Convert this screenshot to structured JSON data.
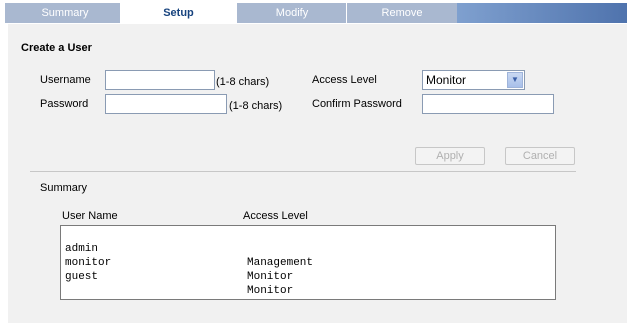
{
  "tabs": [
    {
      "label": "Summary",
      "active": false
    },
    {
      "label": "Setup",
      "active": true
    },
    {
      "label": "Modify",
      "active": false
    },
    {
      "label": "Remove",
      "active": false
    }
  ],
  "form": {
    "title": "Create a User",
    "username_label": "Username",
    "username_value": "",
    "username_hint": "(1-8 chars)",
    "password_label": "Password",
    "password_value": "",
    "password_hint": "(1-8 chars)",
    "access_level_label": "Access Level",
    "access_level_value": "Monitor",
    "confirm_password_label": "Confirm Password",
    "confirm_password_value": "",
    "apply_label": "Apply",
    "cancel_label": "Cancel"
  },
  "summary": {
    "title": "Summary",
    "col_username": "User Name",
    "col_access": "Access Level",
    "rows": [
      {
        "user": "admin",
        "level": "Management"
      },
      {
        "user": "monitor",
        "level": "Monitor"
      },
      {
        "user": "guest",
        "level": "Monitor"
      }
    ]
  },
  "colors": {
    "tab_inactive": "#a9b8d0",
    "tab_active_text": "#17437e",
    "panel_bg": "#f1f1f1"
  }
}
